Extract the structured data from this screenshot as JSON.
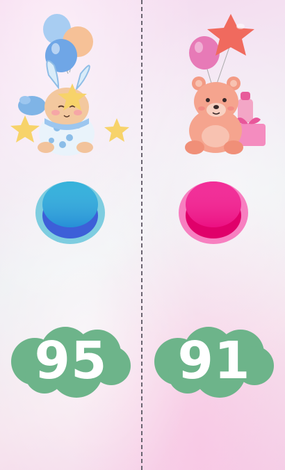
{
  "players": [
    {
      "side": "left",
      "mascot_icon": "bunny-with-balloons-icon",
      "button_color": "#1aa8d6",
      "button_ring_color": "#7ecde0",
      "score": "95"
    },
    {
      "side": "right",
      "mascot_icon": "teddy-bear-with-balloons-icon",
      "button_color": "#f0168c",
      "button_ring_color": "#f77fc0",
      "score": "91"
    }
  ],
  "score_cloud_color": "#6db48a"
}
